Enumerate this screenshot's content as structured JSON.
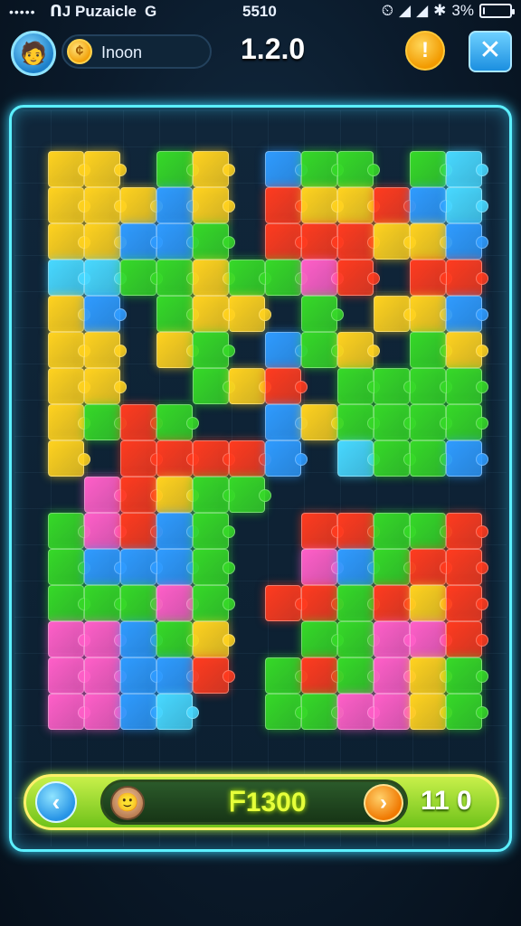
{
  "status_bar": {
    "signal_dots": "•••••",
    "carrier": "ᑎJ Puzaicle",
    "network": "G",
    "time": "5510",
    "battery": "3%",
    "battery_level": 0.03
  },
  "top_bar": {
    "coin_glyph": "¢",
    "coin_label": "Inoon",
    "version": "1.2.0",
    "hint_glyph": "!",
    "close_glyph": "✕"
  },
  "colors": {
    "yellow": "#ffd21f",
    "green": "#36d928",
    "blue": "#2f9bff",
    "red": "#ff3b1f",
    "pink": "#ff5fc8",
    "cyan": "#48d8ff",
    "accent": "#5cf0ff"
  },
  "board": {
    "columns": 12,
    "rows": 17,
    "pieces": [
      "Y Y . G Y . B G G . G C",
      "Y Y Y B Y . R Y Y R B C",
      "Y Y B B G . R R R Y Y B",
      "C C G G Y G G P R . R R",
      "Y B . G Y Y . G . Y Y B",
      "Y Y . Y G . B G Y . G Y",
      "Y Y . . G Y R . G G G G",
      "Y G R G . . B Y G G G G",
      "Y . R R R R B . C G G B",
      ". P R Y G G . . . . . .",
      "G P R B G . . R R G G R",
      "G B B B G . . P B G R R",
      "G G G P G . R R G R Y R",
      "P P B G Y . . G G P P R",
      "P P B B R . G R G P Y G",
      "P P B C . . G G P P Y G"
    ]
  },
  "bottom_bar": {
    "back_glyph": "‹",
    "score": "ᖴ1300",
    "next_glyph": "›",
    "moves": "11 0"
  }
}
